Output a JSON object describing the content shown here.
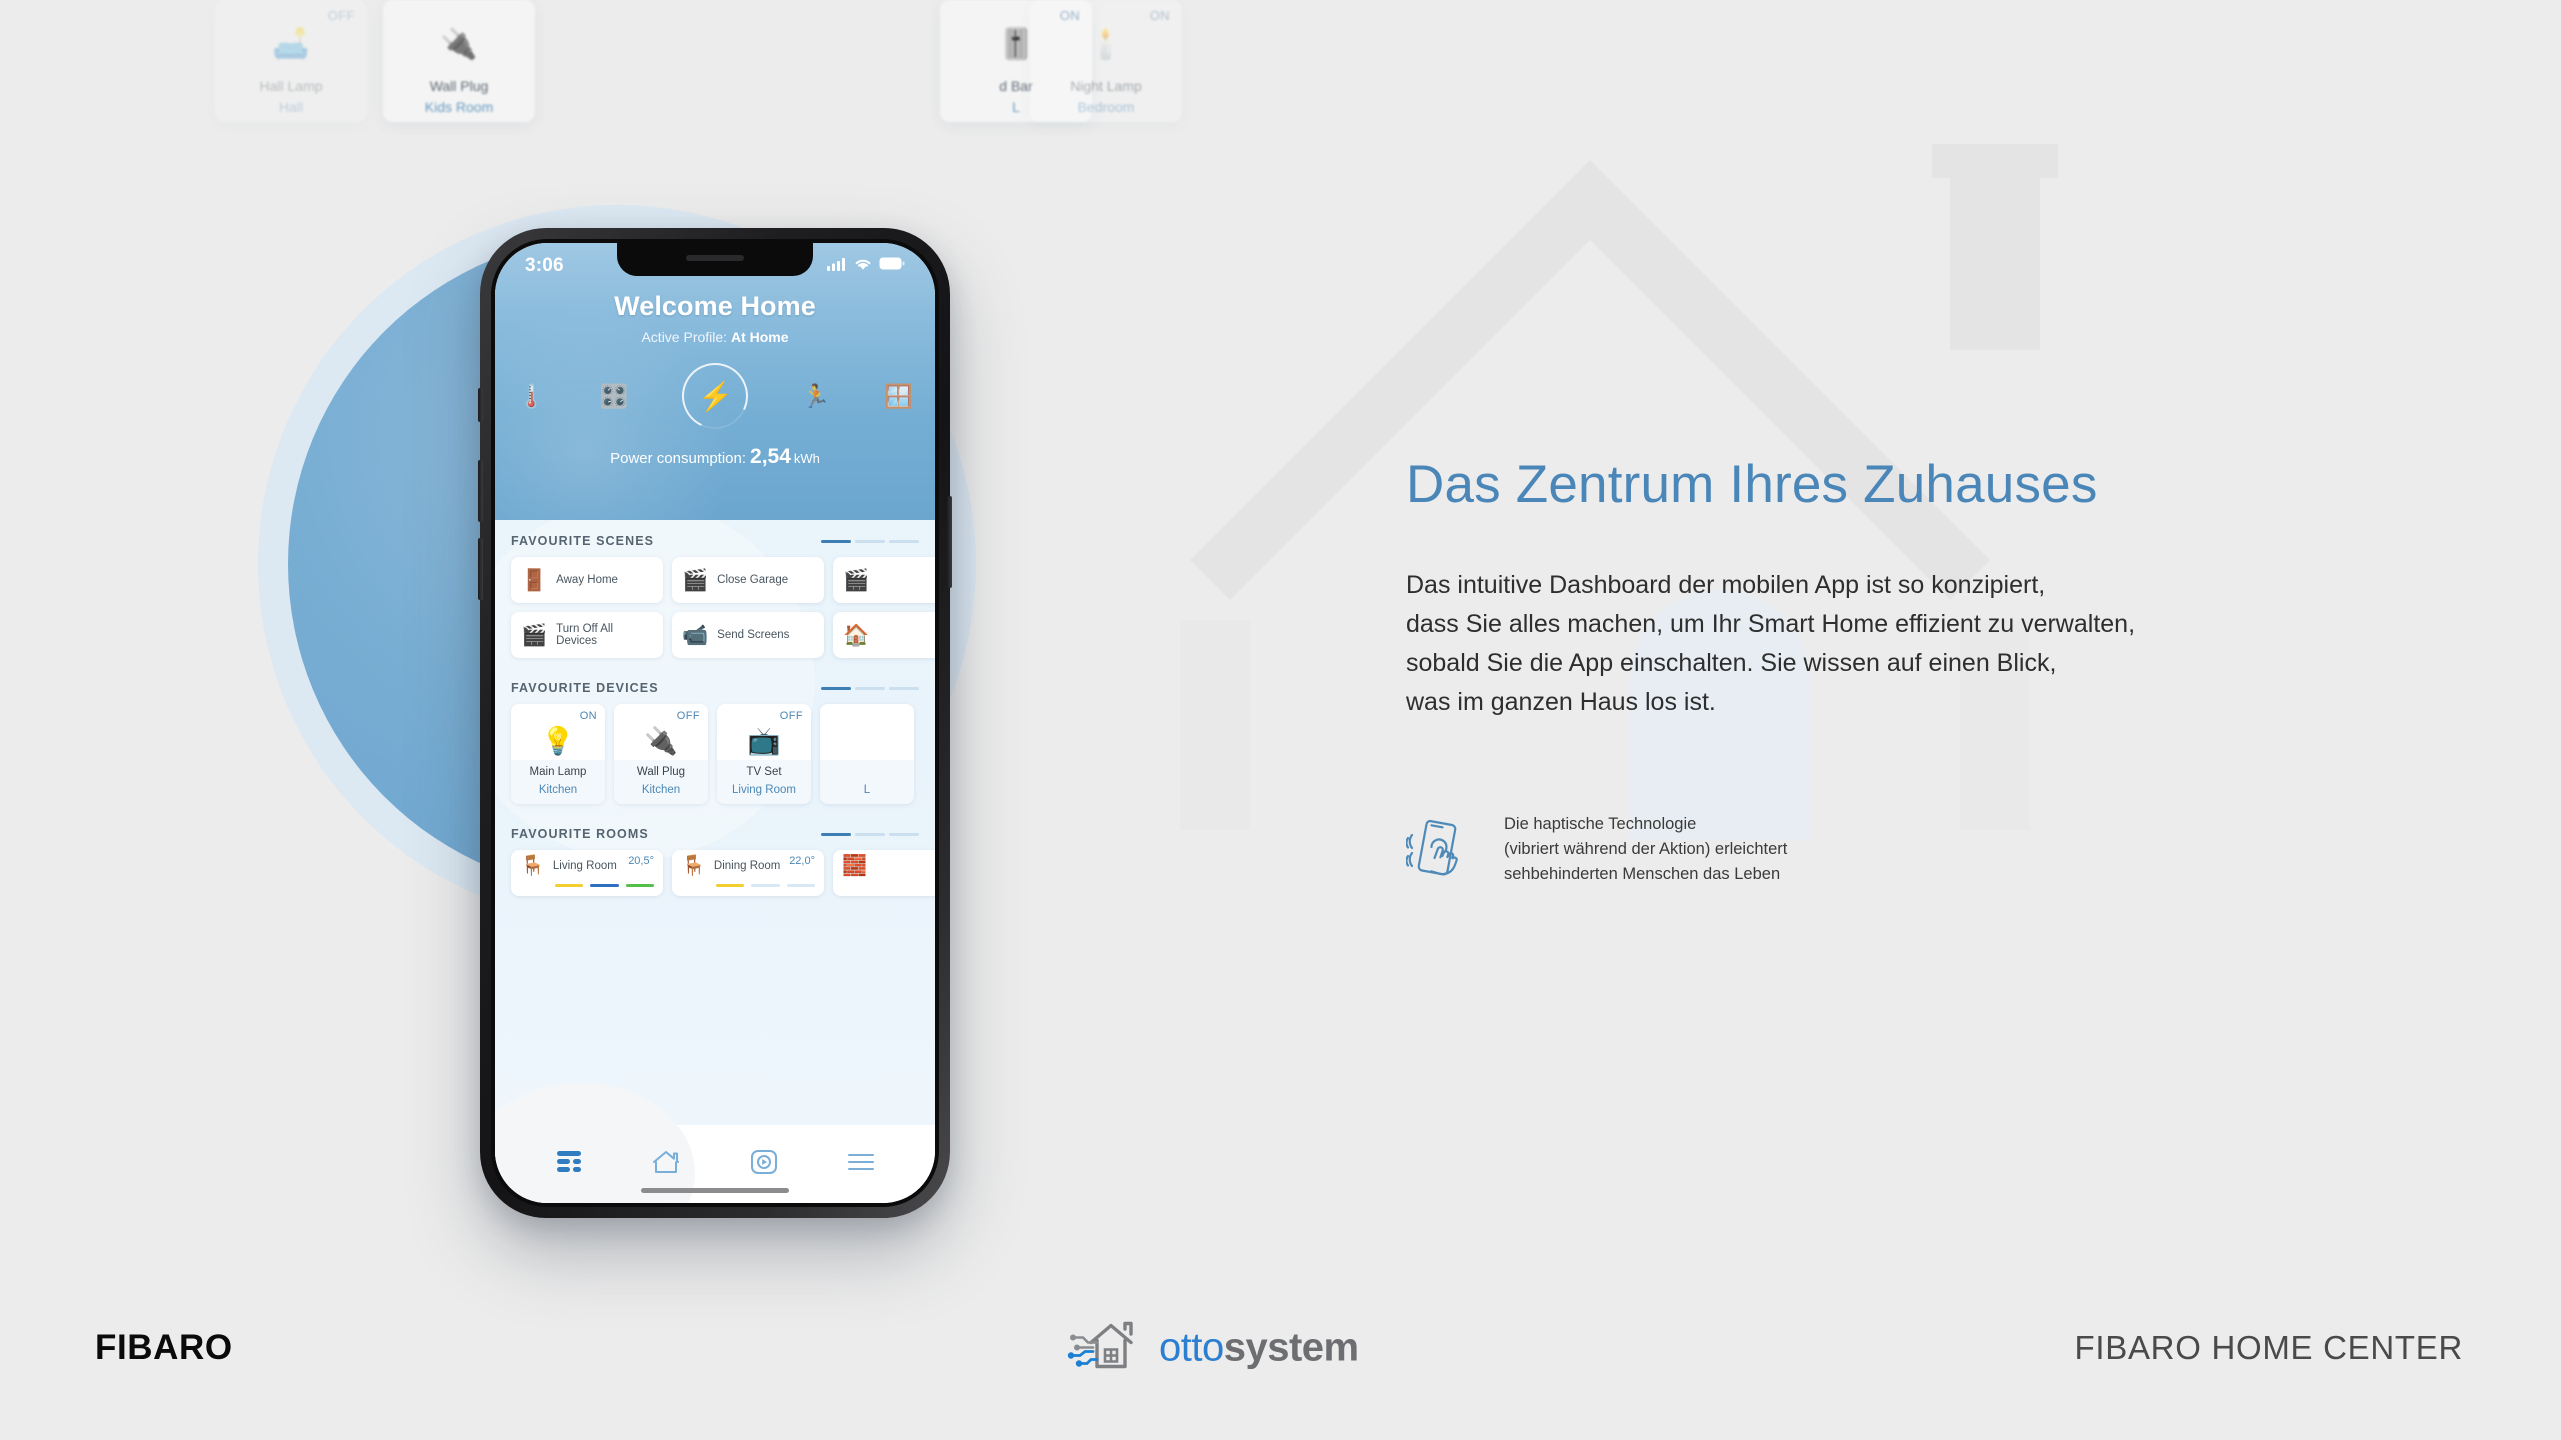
{
  "background": {
    "page_bg": "#ececec",
    "accent_blue": "#4a86b8",
    "circle_blue": "#6ba3cf",
    "watermark": "house-outline-watermark"
  },
  "phone": {
    "status_bar": {
      "time": "3:06",
      "signal_icon": "cellular-signal-icon",
      "wifi_icon": "wifi-icon",
      "battery_icon": "battery-icon"
    },
    "header": {
      "title": "Welcome Home",
      "profile_label": "Active Profile:",
      "profile_value": "At Home",
      "quick_icons": [
        {
          "name": "thermometer-icon",
          "glyph": "🌡️"
        },
        {
          "name": "oven-icon",
          "glyph": "🎛️"
        },
        {
          "name": "energy-bolt-icon",
          "glyph": "⚡"
        },
        {
          "name": "motion-running-icon",
          "glyph": "🏃"
        },
        {
          "name": "blinds-icon",
          "glyph": "🪟"
        }
      ],
      "power_label": "Power consumption:",
      "power_value": "2,54",
      "power_unit": "kWh"
    },
    "sections": {
      "scenes": {
        "title": "FAVOURITE SCENES",
        "items": [
          {
            "label": "Away Home",
            "icon": "open-door-icon",
            "glyph": "🚪"
          },
          {
            "label": "Close Garage",
            "icon": "clapperboard-icon",
            "glyph": "🎬"
          },
          {
            "label": "",
            "icon": "clapperboard-icon",
            "glyph": "🎬"
          },
          {
            "label": "Turn Off All Devices",
            "icon": "clapperboard-icon",
            "glyph": "🎬"
          },
          {
            "label": "Send Screens",
            "icon": "security-camera-icon",
            "glyph": "📹"
          },
          {
            "label": "",
            "icon": "house-icon",
            "glyph": "🏠"
          }
        ]
      },
      "devices": {
        "title": "FAVOURITE DEVICES",
        "items": [
          {
            "name": "Main Lamp",
            "room": "Kitchen",
            "state": "ON",
            "icon": "light-bulb-icon",
            "glyph": "💡"
          },
          {
            "name": "Wall Plug",
            "room": "Kitchen",
            "state": "OFF",
            "icon": "wall-plug-icon",
            "glyph": "🔌"
          },
          {
            "name": "TV Set",
            "room": "Living Room",
            "state": "OFF",
            "icon": "television-icon",
            "glyph": "📺"
          },
          {
            "name": "",
            "room": "L",
            "state": "",
            "icon": "device-icon",
            "glyph": ""
          }
        ]
      },
      "rooms": {
        "title": "FAVOURITE ROOMS",
        "items": [
          {
            "name": "Living Room",
            "temp": "20,5°",
            "icon": "armchair-icon",
            "glyph": "🪑",
            "bars": [
              "#f2cf2f",
              "#2f6fc0",
              "#54c04a"
            ]
          },
          {
            "name": "Dining Room",
            "temp": "22,0°",
            "icon": "dining-table-icon",
            "glyph": "🪑",
            "bars": [
              "#f2cf2f",
              "#d8e8f4",
              "#d8e8f4"
            ]
          },
          {
            "name": "",
            "temp": "",
            "icon": "toy-blocks-icon",
            "glyph": "🧱",
            "bars": []
          }
        ]
      }
    },
    "navbar": [
      {
        "name": "dashboard-tab",
        "active": true
      },
      {
        "name": "home-tab",
        "active": false
      },
      {
        "name": "media-tab",
        "active": false
      },
      {
        "name": "menu-tab",
        "active": false
      }
    ]
  },
  "ghost_cards": [
    {
      "name": "Hall Lamp",
      "room": "Hall",
      "state": "OFF",
      "glyph": "🛋️"
    },
    {
      "name": "Wall Plug",
      "room": "Kids Room",
      "state": "",
      "glyph": "🔌"
    },
    {
      "name": "d Bar",
      "room": "L",
      "state": "ON",
      "glyph": "🎚️"
    },
    {
      "name": "Night Lamp",
      "room": "Bedroom",
      "state": "ON",
      "glyph": "🕯️"
    }
  ],
  "right_column": {
    "headline": "Das Zentrum Ihres Zuhauses",
    "body_lines": [
      "Das intuitive Dashboard der mobilen App ist so konzipiert,",
      "dass Sie alles machen, um Ihr Smart Home effizient zu verwalten,",
      "sobald Sie die App einschalten. Sie wissen auf einen Blick,",
      "was im ganzen Haus los ist."
    ],
    "haptic": {
      "icon": "haptic-touch-phone-icon",
      "lines": [
        "Die haptische Technologie",
        "(vibriert während der Aktion) erleichtert",
        "sehbehinderten Menschen das Leben"
      ]
    }
  },
  "footer": {
    "brand_left": "FIBARO",
    "logo_otto": "otto",
    "logo_system": "system",
    "logo_icon": "ottosystem-house-circuit-logo",
    "brand_right": "FIBARO HOME CENTER"
  }
}
